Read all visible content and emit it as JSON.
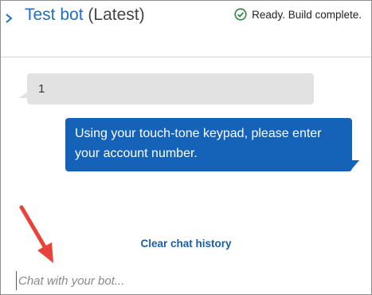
{
  "header": {
    "title": "Test bot",
    "version": "(Latest)",
    "status_text": "Ready. Build complete."
  },
  "messages": [
    {
      "sender": "user",
      "text": "1"
    },
    {
      "sender": "bot",
      "text": "Using your touch-tone keypad, please enter your account number."
    }
  ],
  "actions": {
    "clear_chat": "Clear chat history"
  },
  "input": {
    "placeholder": "Chat with your bot...",
    "value": ""
  },
  "colors": {
    "title": "#1f6fc0",
    "bot_bubble": "#1463b9",
    "user_bubble": "#e2e2e2",
    "status_ok": "#2e8540",
    "link": "#1a5ea8",
    "annotation_arrow": "#e8433a"
  },
  "icons": {
    "collapse": "chevron-right-icon",
    "status": "check-circle-icon",
    "annotation": "arrow-pointer-icon"
  }
}
